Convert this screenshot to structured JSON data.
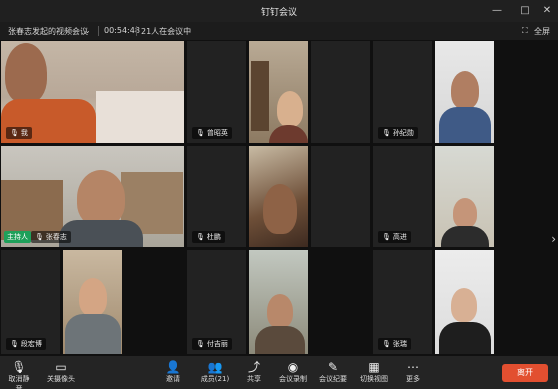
{
  "window": {
    "title": "钉钉会议",
    "controls": {
      "minimize": "—",
      "maximize": "□",
      "close": "✕"
    }
  },
  "infobar": {
    "meeting_name": "张春志发起的视频会议",
    "dropdown_icon": "chevron-down-icon",
    "duration": "00:54:48",
    "attendees": "21人在会议中",
    "fullscreen_label": "全屏"
  },
  "participants": [
    {
      "name": "我",
      "mic": "muted"
    },
    {
      "name": "曾昭英",
      "mic": "muted"
    },
    {
      "name": "",
      "mic": ""
    },
    {
      "name": "孙纪勋",
      "mic": "muted"
    },
    {
      "name": "",
      "mic": ""
    },
    {
      "name": "张春志",
      "mic": "on",
      "host_badge": "主持人"
    },
    {
      "name": "杜鹏",
      "mic": "muted"
    },
    {
      "name": "",
      "mic": ""
    },
    {
      "name": "高进",
      "mic": "on"
    },
    {
      "name": "",
      "mic": ""
    },
    {
      "name": "段宏博",
      "mic": "muted"
    },
    {
      "name": "",
      "mic": ""
    },
    {
      "name": "付吉丽",
      "mic": "muted"
    },
    {
      "name": "",
      "mic": ""
    },
    {
      "name": "张瑞",
      "mic": "muted"
    }
  ],
  "toolbar": {
    "mute_label": "取消静音",
    "camera_label": "关摄像头",
    "invite_label": "邀请",
    "members_label": "成员(21)",
    "share_label": "共享",
    "record_label": "会议录制",
    "minutes_label": "会议纪要",
    "switch_view_label": "切换视图",
    "more_label": "更多",
    "leave_label": "离开"
  },
  "colors": {
    "host_badge": "#1fa05a",
    "leave_button": "#e24f30",
    "background": "#1a1a1a"
  }
}
